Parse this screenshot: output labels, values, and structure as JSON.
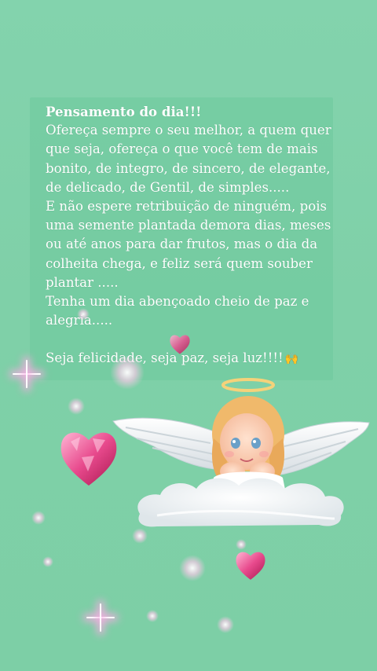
{
  "post": {
    "title": "Pensamento do dia!!!",
    "lines": [
      "Ofereça sempre o seu melhor, a quem quer",
      "que seja, ofereça o que você tem de mais",
      "bonito, de integro, de sincero, de elegante,",
      "de delicado, de Gentil, de simples.....",
      "E não espere retribuição de ninguém, pois",
      "uma semente plantada demora dias, meses",
      "ou até anos para dar frutos, mas o dia da",
      "colheita chega, e feliz será quem souber",
      "plantar .....",
      "Tenha um dia abençoado cheio de paz e",
      "alegria....."
    ],
    "closing": "Seja felicidade, seja paz, seja luz!!!!",
    "closing_emoji": "🙌"
  },
  "decoration": {
    "angel": "angel-on-cloud",
    "icons": [
      "heart-icon",
      "sparkle-icon"
    ],
    "background_color": "#7fd0a8"
  }
}
